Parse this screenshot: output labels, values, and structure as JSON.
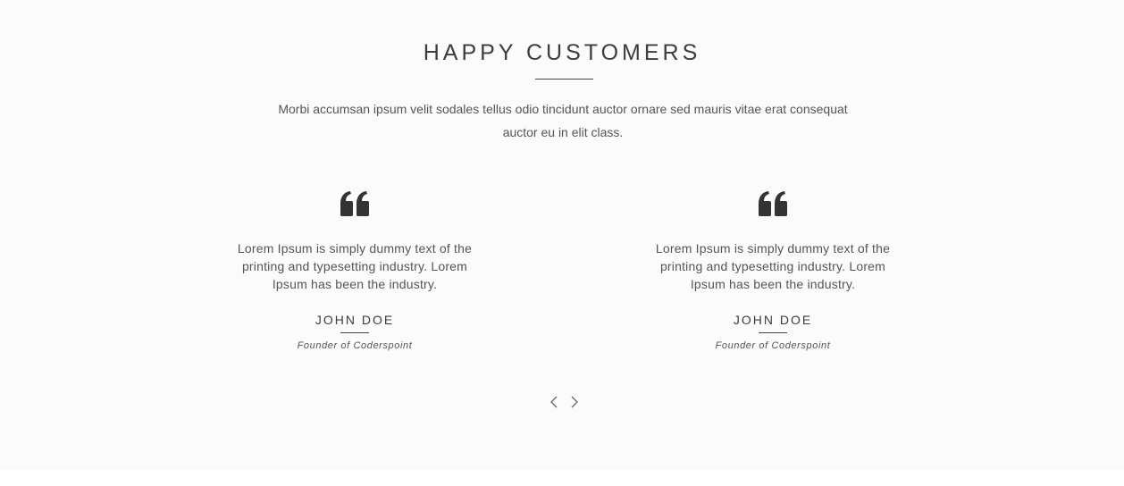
{
  "section": {
    "title": "HAPPY CUSTOMERS",
    "intro": "Morbi accumsan ipsum velit sodales tellus odio tincidunt auctor ornare sed mauris vitae erat consequat auctor eu in elit class."
  },
  "testimonials": [
    {
      "icon": "quote-icon",
      "text": "Lorem Ipsum is simply dummy text of the printing and typesetting industry. Lorem Ipsum has been the industry.",
      "name": "JOHN DOE",
      "role": "Founder of Coderspoint"
    },
    {
      "icon": "quote-icon",
      "text": "Lorem Ipsum is simply dummy text of the printing and typesetting industry. Lorem Ipsum has been the industry.",
      "name": "JOHN DOE",
      "role": "Founder of Coderspoint"
    }
  ],
  "carousel": {
    "prev_icon": "chevron-left-icon",
    "next_icon": "chevron-right-icon"
  },
  "colors": {
    "background": "#fbfbfb",
    "text": "#555555",
    "heading": "#3d3d3d",
    "icon": "#333333"
  }
}
